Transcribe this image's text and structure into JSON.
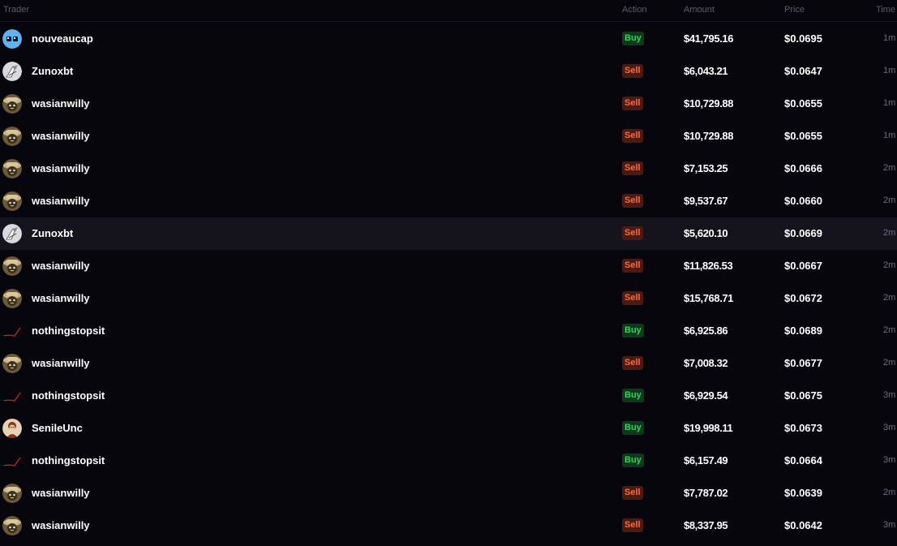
{
  "columns": {
    "trader": "Trader",
    "action": "Action",
    "amount": "Amount",
    "price": "Price",
    "time": "Time"
  },
  "colors": {
    "background": "#07060d",
    "buy_text": "#2fd45a",
    "buy_bg": "#0c3a1a",
    "sell_text": "#ff6a3d",
    "sell_bg": "#4a1a14",
    "row_hover": "#15141c"
  },
  "rows": [
    {
      "avatar": "blue-eyes-avatar",
      "trader": "nouveaucap",
      "action": "Buy",
      "side": "buy",
      "amount": "$41,795.16",
      "price": "$0.0695",
      "time": "1m"
    },
    {
      "avatar": "white-bird-avatar",
      "trader": "Zunoxbt",
      "action": "Sell",
      "side": "sell",
      "amount": "$6,043.21",
      "price": "$0.0647",
      "time": "1m"
    },
    {
      "avatar": "cat-hat-avatar",
      "trader": "wasianwilly",
      "action": "Sell",
      "side": "sell",
      "amount": "$10,729.88",
      "price": "$0.0655",
      "time": "1m"
    },
    {
      "avatar": "cat-hat-avatar",
      "trader": "wasianwilly",
      "action": "Sell",
      "side": "sell",
      "amount": "$10,729.88",
      "price": "$0.0655",
      "time": "1m"
    },
    {
      "avatar": "cat-hat-avatar",
      "trader": "wasianwilly",
      "action": "Sell",
      "side": "sell",
      "amount": "$7,153.25",
      "price": "$0.0666",
      "time": "2m"
    },
    {
      "avatar": "cat-hat-avatar",
      "trader": "wasianwilly",
      "action": "Sell",
      "side": "sell",
      "amount": "$9,537.67",
      "price": "$0.0660",
      "time": "2m"
    },
    {
      "avatar": "white-bird-avatar",
      "trader": "Zunoxbt",
      "action": "Sell",
      "side": "sell",
      "amount": "$5,620.10",
      "price": "$0.0669",
      "time": "2m"
    },
    {
      "avatar": "cat-hat-avatar",
      "trader": "wasianwilly",
      "action": "Sell",
      "side": "sell",
      "amount": "$11,826.53",
      "price": "$0.0667",
      "time": "2m"
    },
    {
      "avatar": "cat-hat-avatar",
      "trader": "wasianwilly",
      "action": "Sell",
      "side": "sell",
      "amount": "$15,768.71",
      "price": "$0.0672",
      "time": "2m"
    },
    {
      "avatar": "red-line-avatar",
      "trader": "nothingstopsit",
      "action": "Buy",
      "side": "buy",
      "amount": "$6,925.86",
      "price": "$0.0689",
      "time": "2m"
    },
    {
      "avatar": "cat-hat-avatar",
      "trader": "wasianwilly",
      "action": "Sell",
      "side": "sell",
      "amount": "$7,008.32",
      "price": "$0.0677",
      "time": "2m"
    },
    {
      "avatar": "red-line-avatar",
      "trader": "nothingstopsit",
      "action": "Buy",
      "side": "buy",
      "amount": "$6,929.54",
      "price": "$0.0675",
      "time": "3m"
    },
    {
      "avatar": "brown-character-avatar",
      "trader": "SenileUnc",
      "action": "Buy",
      "side": "buy",
      "amount": "$19,998.11",
      "price": "$0.0673",
      "time": "3m"
    },
    {
      "avatar": "red-line-avatar",
      "trader": "nothingstopsit",
      "action": "Buy",
      "side": "buy",
      "amount": "$6,157.49",
      "price": "$0.0664",
      "time": "3m"
    },
    {
      "avatar": "cat-hat-avatar",
      "trader": "wasianwilly",
      "action": "Sell",
      "side": "sell",
      "amount": "$7,787.02",
      "price": "$0.0639",
      "time": "2m"
    },
    {
      "avatar": "cat-hat-avatar",
      "trader": "wasianwilly",
      "action": "Sell",
      "side": "sell",
      "amount": "$8,337.95",
      "price": "$0.0642",
      "time": "3m"
    }
  ]
}
